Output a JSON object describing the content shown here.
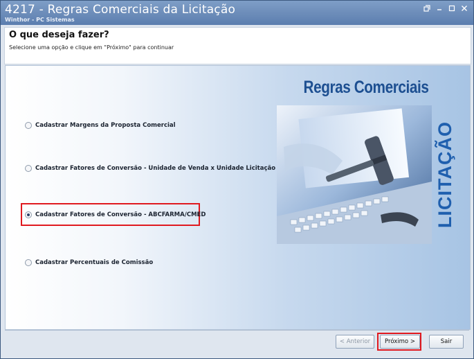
{
  "window": {
    "title": "4217 - Regras Comerciais da Licitação",
    "subtitle": "Winthor - PC Sistemas"
  },
  "header": {
    "title": "O que deseja fazer?",
    "instruction": "Selecione uma opção e clique em \"Próximo\" para continuar"
  },
  "options": [
    {
      "label": "Cadastrar Margens da Proposta Comercial",
      "selected": false
    },
    {
      "label": "Cadastrar Fatores de Conversão - Unidade de Venda x Unidade Licitação",
      "selected": false
    },
    {
      "label": "Cadastrar Fatores de Conversão - ABCFARMA/CMED",
      "selected": true
    },
    {
      "label": "Cadastrar Percentuais de Comissão",
      "selected": false
    }
  ],
  "artwork": {
    "title": "Regras Comerciais",
    "side_text": "LICITAÇÃO"
  },
  "footer": {
    "back_label": "< Anterior",
    "next_label": "Próximo >",
    "exit_label": "Sair"
  },
  "colors": {
    "title_bar": "#6f8fbb",
    "highlight": "#e0191f",
    "artwork_text": "#1d4f91"
  }
}
